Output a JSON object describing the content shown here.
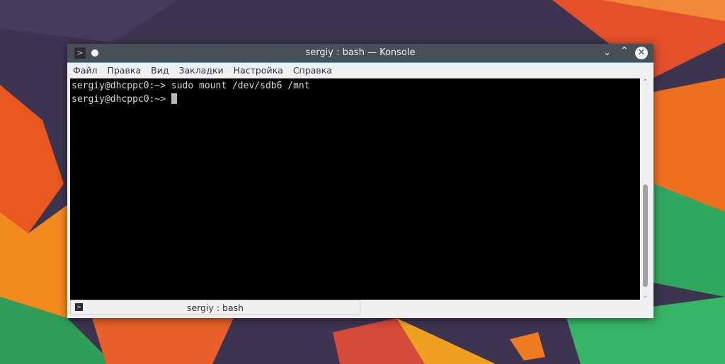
{
  "window": {
    "title": "sergiy : bash — Konsole"
  },
  "menu": [
    "Файл",
    "Правка",
    "Вид",
    "Закладки",
    "Настройка",
    "Справка"
  ],
  "terminal": {
    "lines": [
      {
        "prompt": "sergiy@dhcppc0:~>",
        "command": "sudo mount /dev/sdb6 /mnt"
      },
      {
        "prompt": "sergiy@dhcppc0:~>",
        "command": ""
      }
    ]
  },
  "tabs": [
    {
      "label": "sergiy : bash"
    }
  ]
}
